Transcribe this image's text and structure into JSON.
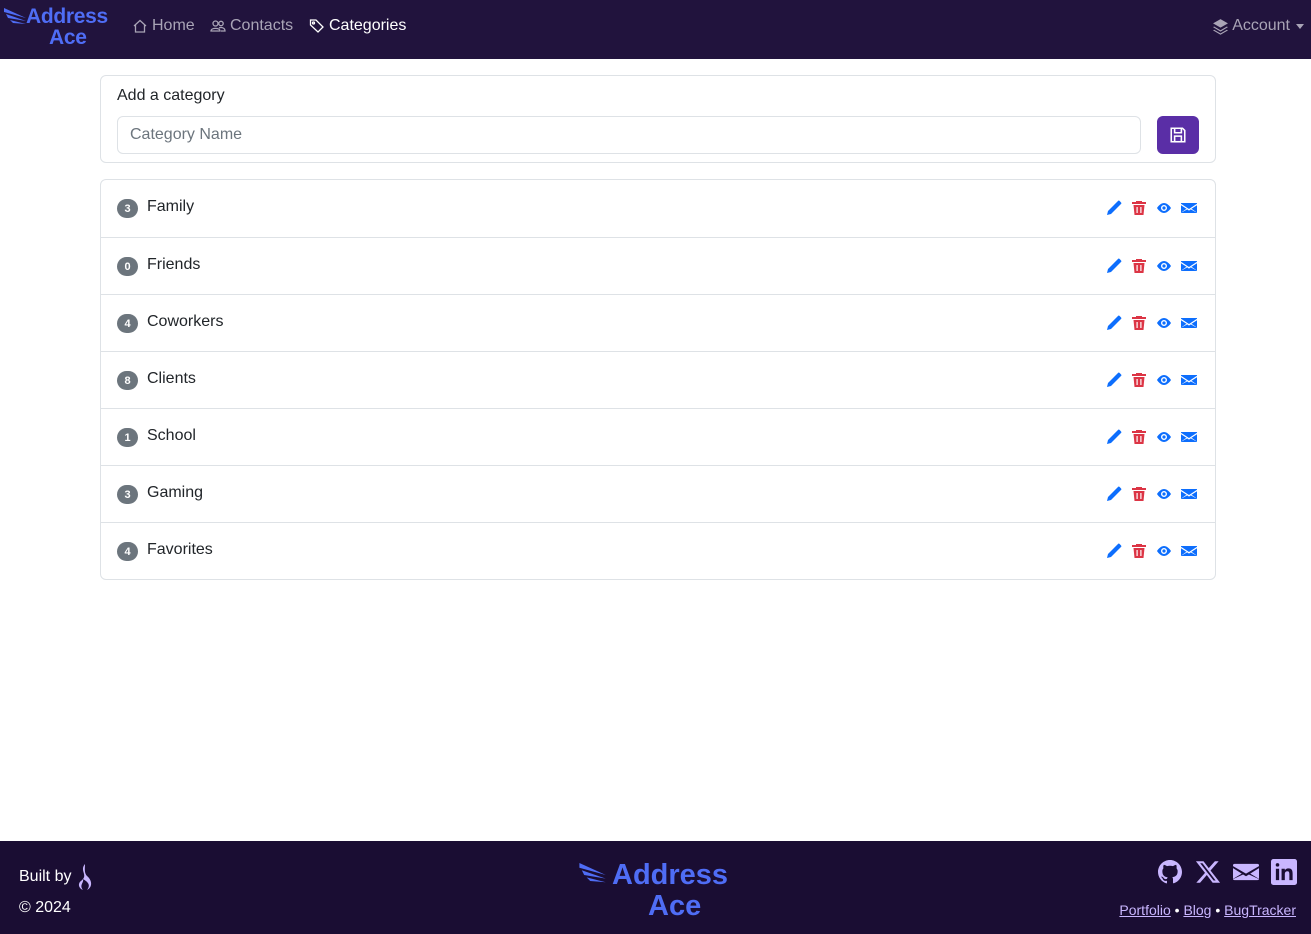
{
  "navbar": {
    "brand_line1": "Address",
    "brand_line2": "Ace",
    "links": [
      {
        "label": "Home",
        "icon": "house-icon"
      },
      {
        "label": "Contacts",
        "icon": "people-icon"
      },
      {
        "label": "Categories",
        "icon": "tags-icon",
        "active": true
      }
    ],
    "account_label": "Account",
    "bg_color": "#21133d",
    "brand_color": "#4f6df5"
  },
  "add_category": {
    "title": "Add a category",
    "input_placeholder": "Category Name",
    "input_value": "",
    "save_icon": "floppy-disk-icon",
    "save_color": "#5a2ea6"
  },
  "categories": [
    {
      "count": "3",
      "name": "Family"
    },
    {
      "count": "0",
      "name": "Friends"
    },
    {
      "count": "4",
      "name": "Coworkers"
    },
    {
      "count": "8",
      "name": "Clients"
    },
    {
      "count": "1",
      "name": "School"
    },
    {
      "count": "3",
      "name": "Gaming"
    },
    {
      "count": "4",
      "name": "Favorites"
    }
  ],
  "row_actions": {
    "edit_icon": "pencil-icon",
    "delete_icon": "trash-icon",
    "view_icon": "eye-icon",
    "email_icon": "envelope-icon",
    "edit_color": "#0d6efd",
    "delete_color": "#dc3545"
  },
  "footer": {
    "built_by": "Built by",
    "copyright": "© 2024",
    "brand_line1": "Address",
    "brand_line2": "Ace",
    "socials": [
      "github-icon",
      "x-icon",
      "envelope-icon",
      "linkedin-icon"
    ],
    "links": [
      "Portfolio",
      "Blog",
      "BugTracker"
    ],
    "separator": "•"
  }
}
